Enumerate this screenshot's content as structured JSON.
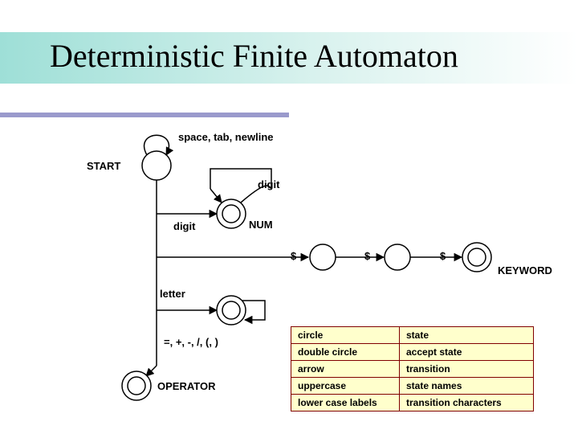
{
  "title": "Deterministic Finite Automaton",
  "labels": {
    "start": "START",
    "loop_start": "space, tab, newline",
    "loop_num": "digit",
    "to_num": "digit",
    "num": "NUM",
    "dollar1": "$",
    "dollar2": "$",
    "dollar3": "$",
    "keyword": "KEYWORD",
    "letter": "letter",
    "ops": "=, +, -, /, (, )",
    "operator": "OPERATOR"
  },
  "legend": [
    {
      "k": "circle",
      "v": "state"
    },
    {
      "k": "double circle",
      "v": "accept state"
    },
    {
      "k": "arrow",
      "v": "transition"
    },
    {
      "k": "uppercase",
      "v": "state names"
    },
    {
      "k": "lower case labels",
      "v": "transition characters"
    }
  ],
  "chart_data": {
    "type": "state-diagram",
    "states": [
      {
        "id": "START",
        "accept": false
      },
      {
        "id": "NUM",
        "accept": true
      },
      {
        "id": "K1",
        "accept": false
      },
      {
        "id": "K2",
        "accept": false
      },
      {
        "id": "KEYWORD",
        "accept": true
      },
      {
        "id": "ID",
        "accept": true
      },
      {
        "id": "OPERATOR",
        "accept": true
      }
    ],
    "transitions": [
      {
        "from": "START",
        "to": "START",
        "label": "space, tab, newline"
      },
      {
        "from": "START",
        "to": "NUM",
        "label": "digit"
      },
      {
        "from": "NUM",
        "to": "NUM",
        "label": "digit"
      },
      {
        "from": "START",
        "to": "K1",
        "label": "$"
      },
      {
        "from": "K1",
        "to": "K2",
        "label": "$"
      },
      {
        "from": "K2",
        "to": "KEYWORD",
        "label": "$"
      },
      {
        "from": "START",
        "to": "ID",
        "label": "letter"
      },
      {
        "from": "START",
        "to": "OPERATOR",
        "label": "=, +, -, /, (, )"
      }
    ],
    "legend": {
      "circle": "state",
      "double circle": "accept state",
      "arrow": "transition",
      "uppercase": "state names",
      "lower case labels": "transition characters"
    }
  }
}
